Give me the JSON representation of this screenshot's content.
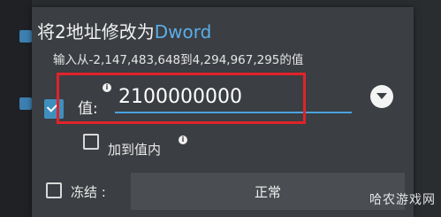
{
  "dialog": {
    "title_prefix": "将2地址修改为",
    "title_type": "Dword",
    "range_hint": "输入从-2,147,483,648到4,294,967,295的值",
    "value_label": "值:",
    "value": "2100000000",
    "add_to_value_label": "加到值内",
    "freeze_label": "冻结 :",
    "freeze_mode": "正常"
  },
  "icons": {
    "info": "i"
  },
  "watermark": "哈农游戏网",
  "colors": {
    "accent": "#5aaee8",
    "highlight": "#e0232b",
    "checkbox_checked": "#3f8fbd"
  }
}
